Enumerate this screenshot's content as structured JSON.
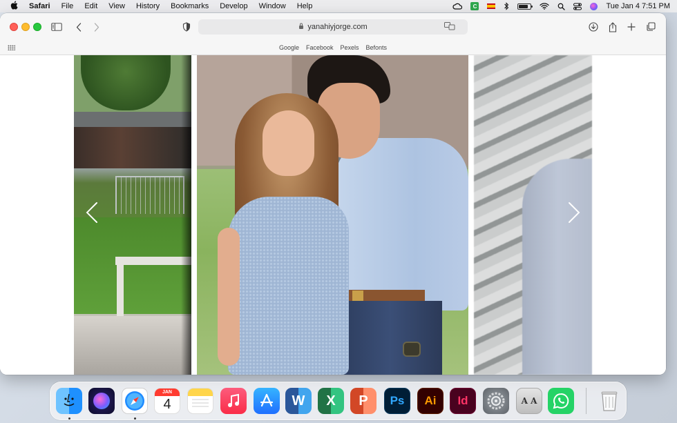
{
  "menubar": {
    "app_name": "Safari",
    "items": [
      "File",
      "Edit",
      "View",
      "History",
      "Bookmarks",
      "Develop",
      "Window",
      "Help"
    ],
    "cc_badge": "C",
    "clock": "Tue Jan 4  7:51 PM",
    "battery_level": 0.8
  },
  "browser": {
    "url": "yanahiyjorge.com",
    "favorites": [
      "Google",
      "Facebook",
      "Pexels",
      "Befonts"
    ]
  },
  "dock": {
    "calendar_month": "JAN",
    "calendar_day": "4",
    "word_letter": "W",
    "excel_letter": "X",
    "powerpoint_letter": "P",
    "photoshop_label": "Ps",
    "illustrator_label": "Ai",
    "indesign_label": "Id",
    "fontbook_label": "A A"
  },
  "colors": {
    "close": "#ff5f57",
    "minimize": "#febc2e",
    "zoom": "#28c840",
    "finder": "#1e90ff",
    "music": "#fa2d48",
    "appstore": "#1f8bff",
    "word": "#2b579a",
    "excel": "#217346",
    "powerpoint": "#d24726",
    "photoshop": "#001e36",
    "illustrator": "#330000",
    "indesign": "#49021f",
    "whatsapp": "#25d366"
  }
}
